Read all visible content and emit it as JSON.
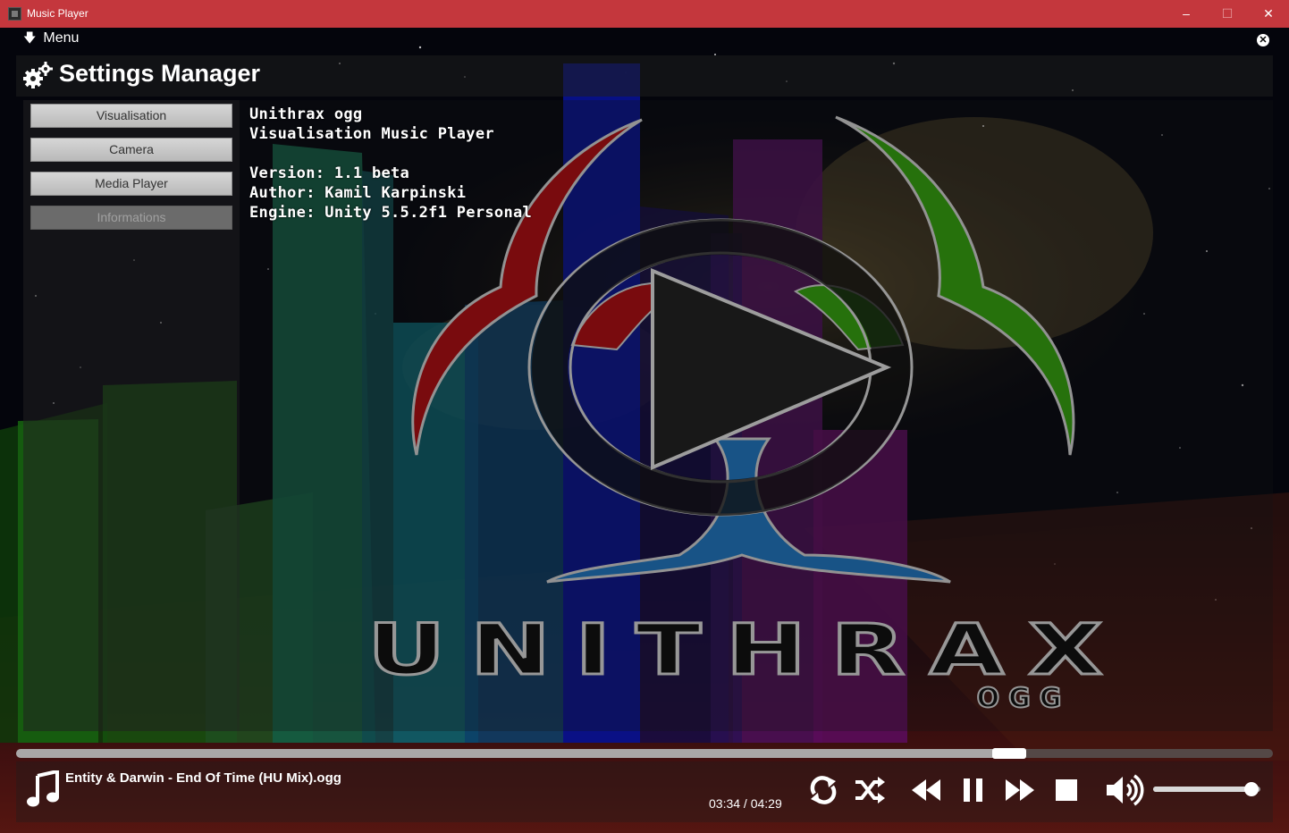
{
  "window": {
    "title": "Music Player",
    "minimize": "–",
    "maximize": "☐",
    "close": "✕"
  },
  "menu": {
    "label": "Menu",
    "close_glyph": "✕"
  },
  "settings": {
    "title": "Settings Manager",
    "buttons": [
      {
        "label": "Visualisation",
        "enabled": true
      },
      {
        "label": "Camera",
        "enabled": true
      },
      {
        "label": "Media Player",
        "enabled": true
      },
      {
        "label": "Informations",
        "enabled": false
      }
    ],
    "info": {
      "app_name": "Unithrax ogg",
      "subtitle": "Visualisation Music Player",
      "version": "Version: 1.1 beta",
      "author": "Author: Kamil Karpinski",
      "engine": "Engine: Unity 5.5.2f1 Personal"
    }
  },
  "logo": {
    "wordmark": "UNITHRAX",
    "sub": "OGG"
  },
  "player": {
    "track": "Entity & Darwin - End Of Time (HU Mix).ogg",
    "time": "03:34 / 04:29",
    "progress": 0.79,
    "volume": 0.92,
    "controls": [
      "repeat-icon",
      "shuffle-icon",
      "rewind-icon",
      "pause-icon",
      "fast-forward-icon",
      "stop-icon",
      "volume-icon"
    ]
  },
  "colors": {
    "titlebar": "#c4373d",
    "logo_red": "#a5080c",
    "logo_green": "#2f9a0a",
    "logo_blue": "#1b6fb8"
  }
}
